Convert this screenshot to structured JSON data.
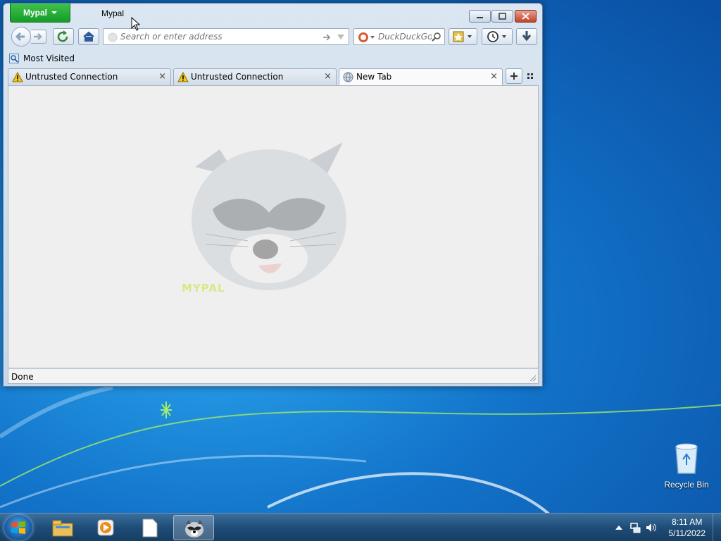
{
  "window": {
    "app_menu_label": "Mypal",
    "title": "Mypal",
    "nav": {
      "url_placeholder": "Search or enter address",
      "search_engine": "DuckDuckGo",
      "search_placeholder": "DuckDuckGo"
    },
    "bookmarks": {
      "most_visited_label": "Most Visited"
    },
    "tabs": [
      {
        "title": "Untrusted Connection",
        "icon": "warning-icon",
        "selected": false
      },
      {
        "title": "Untrusted Connection",
        "icon": "warning-icon",
        "selected": false
      },
      {
        "title": "New Tab",
        "icon": "globe-icon",
        "selected": true
      }
    ],
    "content": {
      "watermark_text": "MYPAL"
    },
    "status": "Done"
  },
  "desktop": {
    "icons": [
      {
        "label": "Recycle Bin",
        "icon": "recycle-bin-icon"
      }
    ]
  },
  "taskbar": {
    "items": [
      {
        "icon": "file-explorer-icon"
      },
      {
        "icon": "media-player-icon"
      },
      {
        "icon": "blank-document-icon"
      },
      {
        "icon": "mypal-raccoon-icon",
        "active": true
      }
    ],
    "clock": {
      "time": "8:11 AM",
      "date": "5/11/2022"
    }
  },
  "colors": {
    "app_button": "#169c2a",
    "desktop": "#1273c9",
    "taskbar": "#1e4d78"
  }
}
